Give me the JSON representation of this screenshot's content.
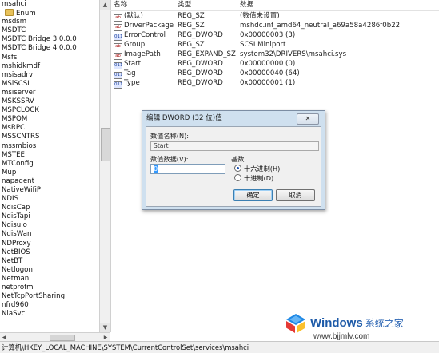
{
  "tree": {
    "items": [
      "msahci",
      "Enum",
      "msdsm",
      "MSDTC",
      "MSDTC Bridge 3.0.0.0",
      "MSDTC Bridge 4.0.0.0",
      "Msfs",
      "mshidkmdf",
      "msisadrv",
      "MSiSCSI",
      "msiserver",
      "MSKSSRV",
      "MSPCLOCK",
      "MSPQM",
      "MsRPC",
      "MSSCNTRS",
      "mssmbios",
      "MSTEE",
      "MTConfig",
      "Mup",
      "napagent",
      "NativeWifiP",
      "NDIS",
      "NdisCap",
      "NdisTapi",
      "Ndisuio",
      "NdisWan",
      "NDProxy",
      "NetBIOS",
      "NetBT",
      "Netlogon",
      "Netman",
      "netprofm",
      "NetTcpPortSharing",
      "nfrd960",
      "NlaSvc"
    ]
  },
  "list": {
    "headers": {
      "name": "名称",
      "type": "类型",
      "data": "数据"
    },
    "rows": [
      {
        "icon": "string-value-icon",
        "name": "(默认)",
        "type": "REG_SZ",
        "data": "(数值未设置)"
      },
      {
        "icon": "string-value-icon",
        "name": "DriverPackageId",
        "type": "REG_SZ",
        "data": "mshdc.inf_amd64_neutral_a69a58a4286f0b22"
      },
      {
        "icon": "dword-value-icon",
        "name": "ErrorControl",
        "type": "REG_DWORD",
        "data": "0x00000003 (3)"
      },
      {
        "icon": "string-value-icon",
        "name": "Group",
        "type": "REG_SZ",
        "data": "SCSI Miniport"
      },
      {
        "icon": "string-value-icon",
        "name": "ImagePath",
        "type": "REG_EXPAND_SZ",
        "data": "system32\\DRIVERS\\msahci.sys"
      },
      {
        "icon": "dword-value-icon",
        "name": "Start",
        "type": "REG_DWORD",
        "data": "0x00000000 (0)"
      },
      {
        "icon": "dword-value-icon",
        "name": "Tag",
        "type": "REG_DWORD",
        "data": "0x00000040 (64)"
      },
      {
        "icon": "dword-value-icon",
        "name": "Type",
        "type": "REG_DWORD",
        "data": "0x00000001 (1)"
      }
    ]
  },
  "dialog": {
    "title": "编辑 DWORD (32 位)值",
    "close_label": "✕",
    "value_name_label": "数值名称(N):",
    "value_name": "Start",
    "value_data_label": "数值数据(V):",
    "value_data": "0",
    "base_label": "基数",
    "radio_hex": "十六进制(H)",
    "radio_dec": "十进制(D)",
    "selected_base": "hex",
    "ok_label": "确定",
    "cancel_label": "取消"
  },
  "status_bar": {
    "path": "计算机\\HKEY_LOCAL_MACHINE\\SYSTEM\\CurrentControlSet\\services\\msahci"
  },
  "watermark": {
    "brand": "Windows",
    "suffix": "系统之家",
    "url": "www.bjjmlv.com"
  }
}
